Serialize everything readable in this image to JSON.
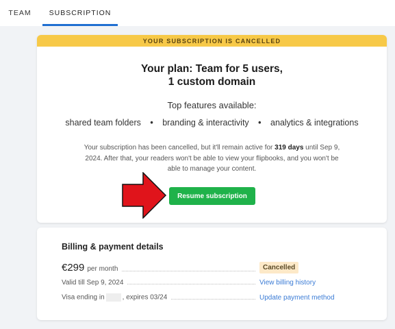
{
  "tabs": [
    {
      "label": "TEAM"
    },
    {
      "label": "SUBSCRIPTION"
    }
  ],
  "plan_card": {
    "banner": "YOUR SUBSCRIPTION IS CANCELLED",
    "title_line1": "Your plan: Team for 5 users,",
    "title_line2": "1 custom domain",
    "features_heading": "Top features available:",
    "features": [
      "shared team folders",
      "branding & interactivity",
      "analytics & integrations"
    ],
    "feature_separator": "•",
    "notice_part1": "Your subscription has been cancelled, but it'll remain active for ",
    "notice_bold": "319 days",
    "notice_part2": " until Sep 9, 2024. After that, your readers won't be able to view your flipbooks, and you won't be able to manage your content.",
    "resume_button": "Resume subscription"
  },
  "billing": {
    "title": "Billing & payment details",
    "price": "€299",
    "price_period": "per month",
    "status_badge": "Cancelled",
    "valid_till": "Valid till Sep 9, 2024",
    "view_history_link": "View billing history",
    "card_prefix": "Visa ending in",
    "card_suffix": ", expires 03/24",
    "update_payment_link": "Update payment method"
  },
  "colors": {
    "banner": "#f7c948",
    "resume_button": "#1fb24a",
    "tab_underline": "#1f6fd1",
    "link": "#3a7bd5",
    "arrow": "#e0141b",
    "badge_bg": "#fde9c8"
  }
}
